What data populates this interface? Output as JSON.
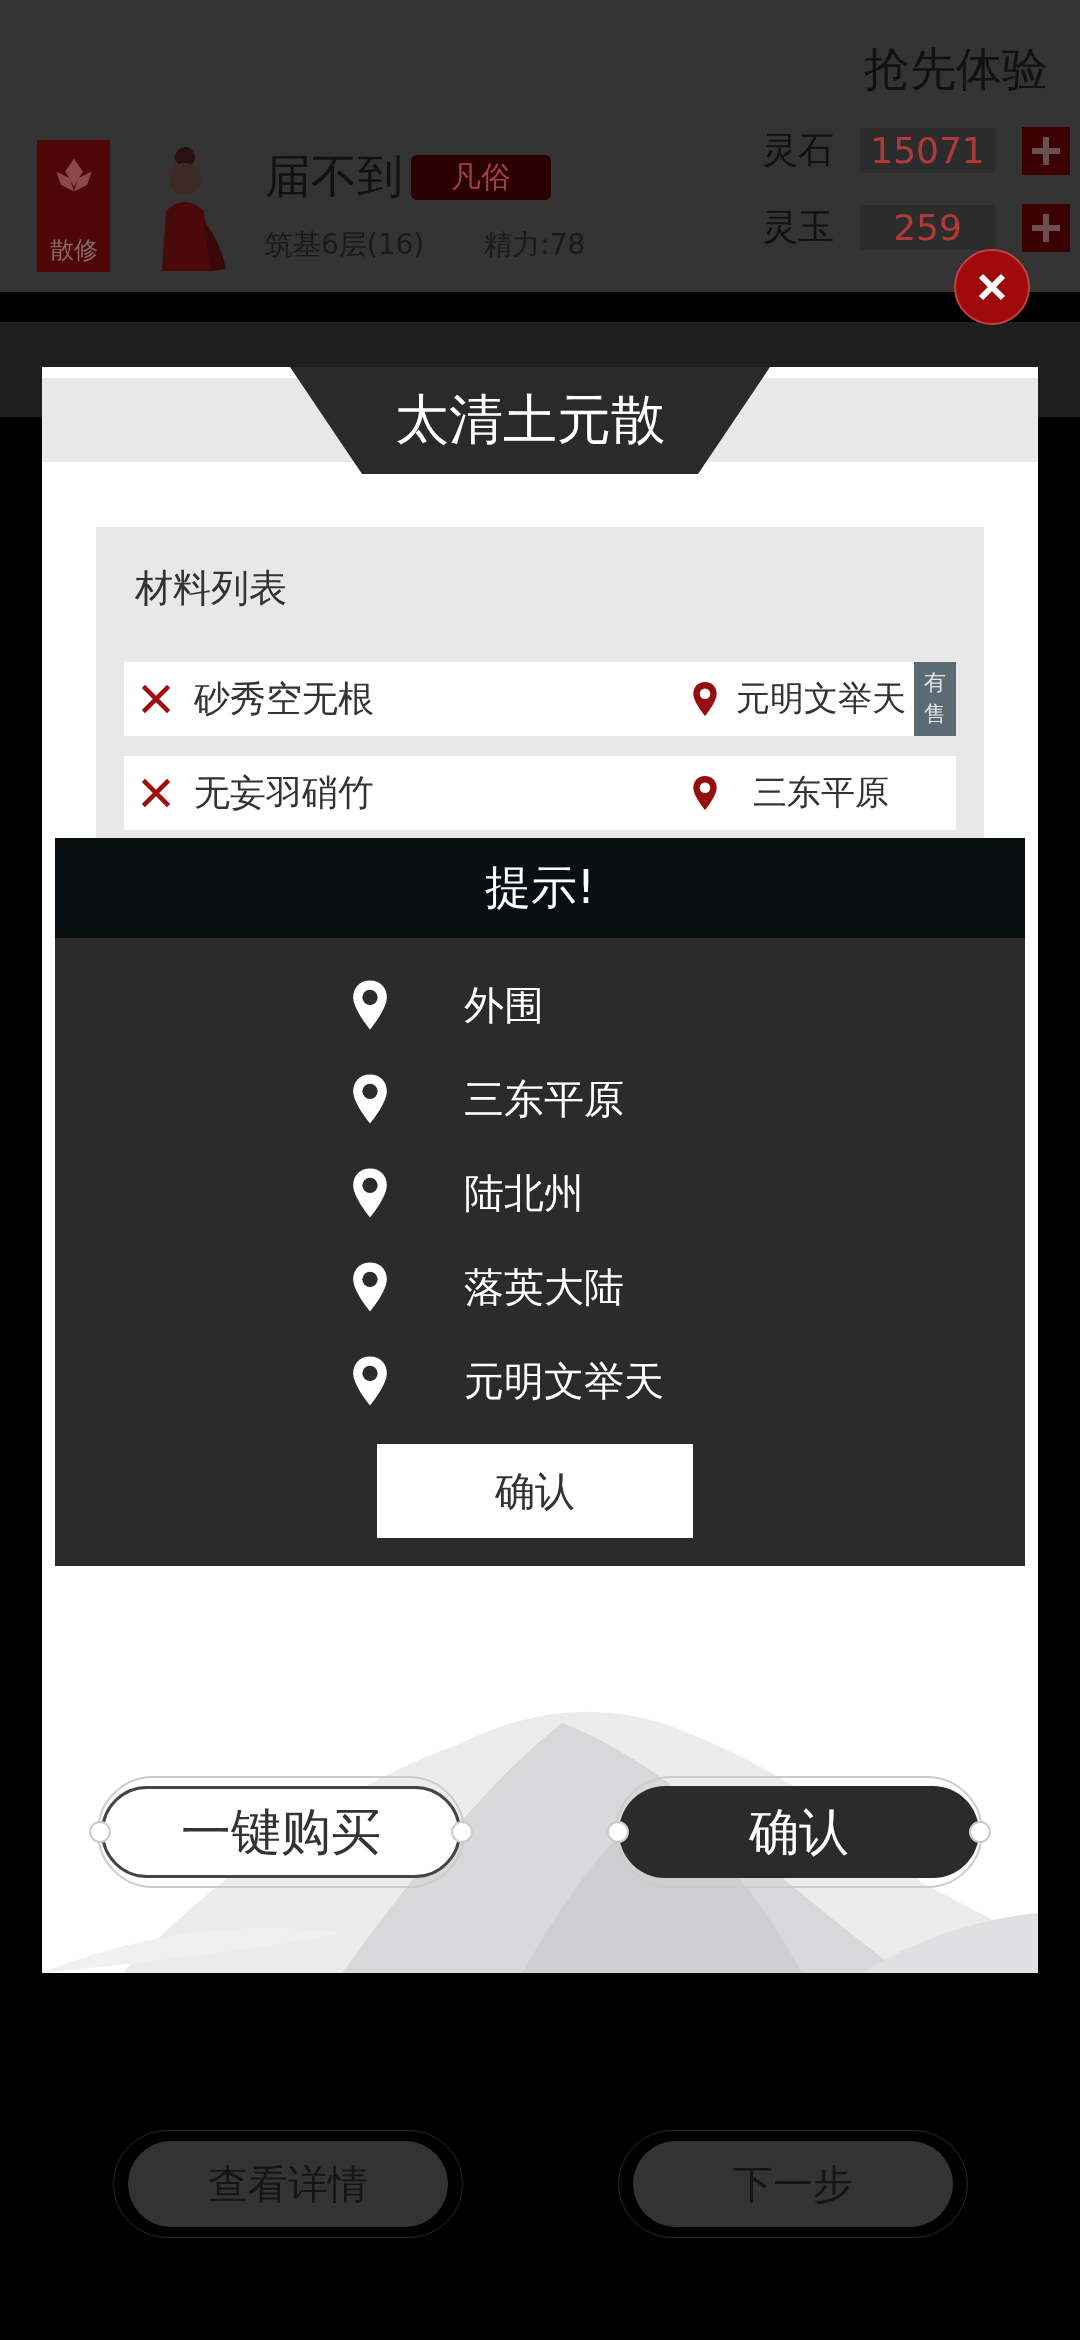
{
  "header": {
    "title": "抢先体验"
  },
  "profile": {
    "sect_badge": "散修",
    "name": "届不到",
    "rank_tag": "凡俗",
    "realm": "筑基6层(16)",
    "energy": "精力:78"
  },
  "currencies": [
    {
      "label": "灵石",
      "value": "15071"
    },
    {
      "label": "灵玉",
      "value": "259"
    }
  ],
  "background_buttons": [
    "查看详情",
    "下一步"
  ],
  "modal": {
    "title": "太清土元散",
    "materials_title": "材料列表",
    "materials": [
      {
        "name": "砂秀空无根",
        "owned": false,
        "location": "元明文举天",
        "badge": "有售"
      },
      {
        "name": "无妄羽硝竹",
        "owned": false,
        "location": "三东平原"
      }
    ],
    "buttons": [
      {
        "label": "一键购买",
        "kind": "outline"
      },
      {
        "label": "确认",
        "kind": "filled"
      }
    ]
  },
  "tip_dialog": {
    "title": "提示!",
    "locations": [
      "外围",
      "三东平原",
      "陆北州",
      "落英大陆",
      "元明文举天"
    ],
    "confirm": "确认"
  }
}
